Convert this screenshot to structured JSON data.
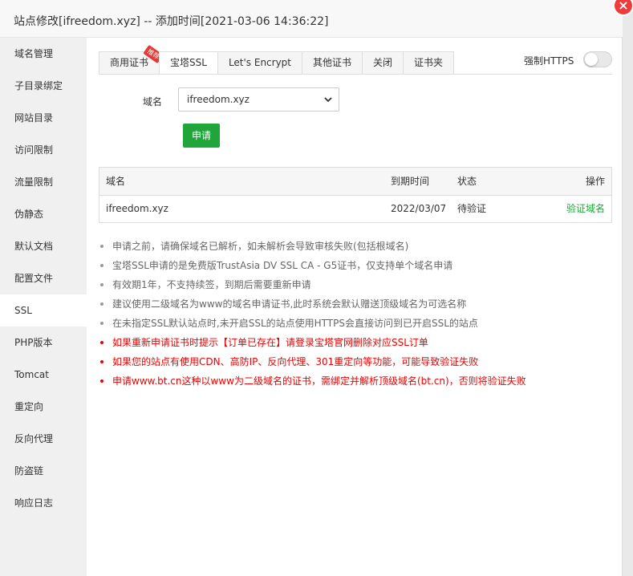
{
  "window": {
    "title": "站点修改[ifreedom.xyz] -- 添加时间[2021-03-06 14:36:22]",
    "close_icon": "×"
  },
  "sidebar": {
    "items": [
      {
        "label": "域名管理"
      },
      {
        "label": "子目录绑定"
      },
      {
        "label": "网站目录"
      },
      {
        "label": "访问限制"
      },
      {
        "label": "流量限制"
      },
      {
        "label": "伪静态"
      },
      {
        "label": "默认文档"
      },
      {
        "label": "配置文件"
      },
      {
        "label": "SSL"
      },
      {
        "label": "PHP版本"
      },
      {
        "label": "Tomcat"
      },
      {
        "label": "重定向"
      },
      {
        "label": "反向代理"
      },
      {
        "label": "防盗链"
      },
      {
        "label": "响应日志"
      }
    ],
    "active": "SSL"
  },
  "tabs": {
    "items": [
      {
        "label": "商用证书",
        "badge": "推荐"
      },
      {
        "label": "宝塔SSL"
      },
      {
        "label": "Let's Encrypt"
      },
      {
        "label": "其他证书"
      },
      {
        "label": "关闭"
      },
      {
        "label": "证书夹"
      }
    ],
    "active": "宝塔SSL"
  },
  "force_https": {
    "label": "强制HTTPS",
    "enabled": false
  },
  "form": {
    "domain_label": "域名",
    "domain_value": "ifreedom.xyz",
    "apply_label": "申请"
  },
  "table": {
    "headers": [
      "域名",
      "到期时间",
      "状态",
      "操作"
    ],
    "rows": [
      {
        "domain": "ifreedom.xyz",
        "expiry": "2022/03/07",
        "status": "待验证",
        "action": "验证域名"
      }
    ]
  },
  "notes": [
    {
      "text": "申请之前，请确保域名已解析，如未解析会导致审核失败(包括根域名)",
      "red": false
    },
    {
      "text": "宝塔SSL申请的是免费版TrustAsia DV SSL CA - G5证书，仅支持单个域名申请",
      "red": false
    },
    {
      "text": "有效期1年，不支持续签，到期后需要重新申请",
      "red": false
    },
    {
      "text": "建议使用二级域名为www的域名申请证书,此时系统会默认赠送顶级域名为可选名称",
      "red": false
    },
    {
      "text": "在未指定SSL默认站点时,未开启SSL的站点使用HTTPS会直接访问到已开启SSL的站点",
      "red": false
    },
    {
      "text": "如果重新申请证书时提示【订单已存在】请登录宝塔官网删除对应SSL订单",
      "red": true
    },
    {
      "text": "如果您的站点有使用CDN、高防IP、反向代理、301重定向等功能，可能导致验证失败",
      "red": true
    },
    {
      "text": "申请www.bt.cn这种以www为二级域名的证书，需绑定并解析顶级域名(bt.cn)，否则将验证失败",
      "red": true
    }
  ],
  "colors": {
    "accent": "#20a53a",
    "danger": "#ee0000",
    "close": "#ee3b3b"
  }
}
